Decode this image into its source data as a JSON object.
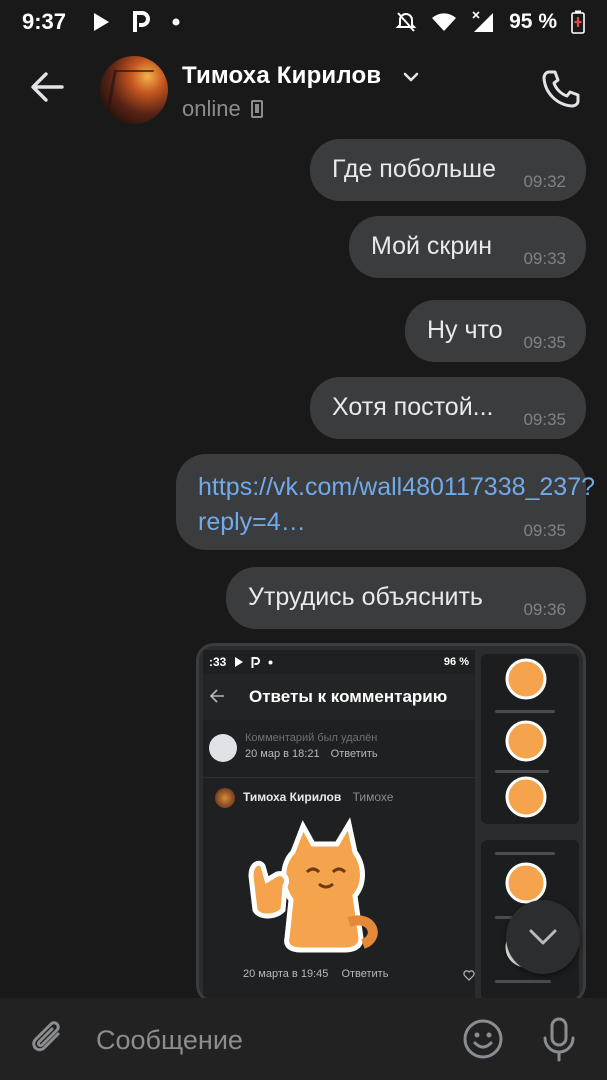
{
  "statusbar": {
    "time": "9:37",
    "battery": "95 %",
    "icons": [
      "play-icon",
      "parking-icon",
      "dot-icon",
      "mute-icon",
      "wifi-icon",
      "signal-icon",
      "battery-icon"
    ]
  },
  "header": {
    "name": "Тимоха Кирилов",
    "status": "online"
  },
  "messages": [
    {
      "text": "Где побольше",
      "time": "09:32"
    },
    {
      "text": "Мой скрин",
      "time": "09:33"
    },
    {
      "text": "Ну что",
      "time": "09:35"
    },
    {
      "text": "Хотя постой...",
      "time": "09:35"
    },
    {
      "text": "https://vk.com/wall480117338_237?reply=4…",
      "time": "09:35",
      "is_link": true
    },
    {
      "text": "Утрудись объяснить",
      "time": "09:36"
    }
  ],
  "attachment": {
    "statusbar_time": ":33",
    "statusbar_battery": "96 %",
    "title": "Ответы к комментарию",
    "deleted_comment": "Комментарий был удалён",
    "deleted_date": "20 мар в 18:21",
    "reply_label": "Ответить",
    "comment_author": "Тимоха Кирилов",
    "comment_to": "Тимохе",
    "comment_date": "20 марта в 19:45",
    "comment_reply": "Ответить"
  },
  "composer": {
    "placeholder": "Сообщение"
  },
  "colors": {
    "background": "#191919",
    "bubble": "#3b3c3e",
    "link": "#71aaeb",
    "composer": "#222223"
  }
}
